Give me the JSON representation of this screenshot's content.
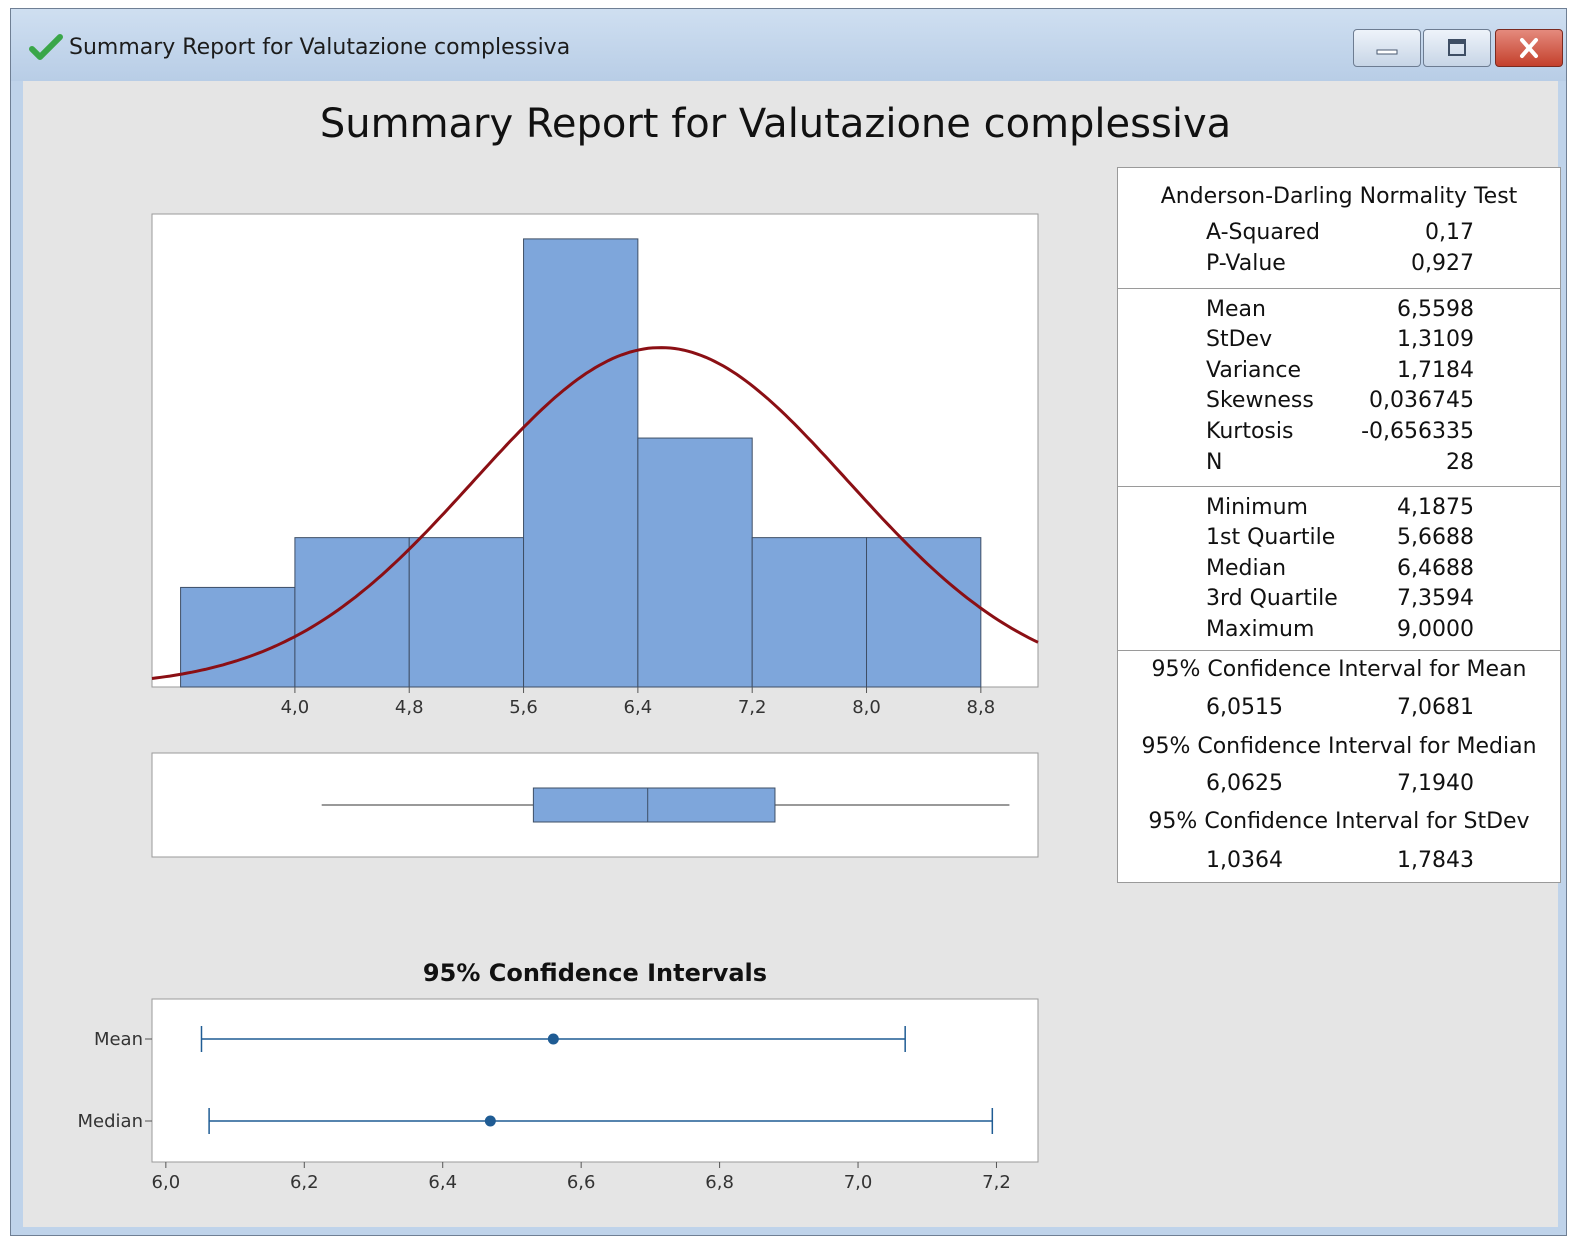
{
  "window": {
    "title": "Summary Report for Valutazione complessiva",
    "icon": "green-checkmark-icon",
    "buttons": [
      "minimize-icon",
      "maximize-icon",
      "close-icon"
    ]
  },
  "report": {
    "title": "Summary Report for Valutazione complessiva"
  },
  "stats": {
    "ad_heading": "Anderson-Darling Normality Test",
    "ad": [
      {
        "label": "A-Squared",
        "value": "0,17"
      },
      {
        "label": "P-Value",
        "value": "0,927"
      }
    ],
    "moments": [
      {
        "label": "Mean",
        "value": "6,5598"
      },
      {
        "label": "StDev",
        "value": "1,3109"
      },
      {
        "label": "Variance",
        "value": "1,7184"
      },
      {
        "label": "Skewness",
        "value": "0,036745"
      },
      {
        "label": "Kurtosis",
        "value": "-0,656335"
      },
      {
        "label": "N",
        "value": "28"
      }
    ],
    "quantiles": [
      {
        "label": "Minimum",
        "value": "4,1875"
      },
      {
        "label": "1st Quartile",
        "value": "5,6688"
      },
      {
        "label": "Median",
        "value": "6,4688"
      },
      {
        "label": "3rd Quartile",
        "value": "7,3594"
      },
      {
        "label": "Maximum",
        "value": "9,0000"
      }
    ],
    "ci": [
      {
        "heading": "95% Confidence Interval for Mean",
        "low": "6,0515",
        "high": "7,0681"
      },
      {
        "heading": "95% Confidence Interval for Median",
        "low": "6,0625",
        "high": "7,1940"
      },
      {
        "heading": "95% Confidence Interval for StDev",
        "low": "1,0364",
        "high": "1,7843"
      }
    ]
  },
  "chart_data": [
    {
      "type": "bar",
      "subtype": "histogram-with-normal-fit",
      "bin_centers": [
        3.6,
        4.4,
        5.2,
        6.0,
        6.8,
        7.6,
        8.4
      ],
      "bin_width": 0.8,
      "counts": [
        2,
        3,
        3,
        9,
        5,
        3,
        3
      ],
      "xlim": [
        3.0,
        9.2
      ],
      "ylim": [
        0,
        9.5
      ],
      "xticks": [
        "4,0",
        "4,8",
        "5,6",
        "6,4",
        "7,2",
        "8,0",
        "8,8"
      ],
      "xtick_values": [
        4.0,
        4.8,
        5.6,
        6.4,
        7.2,
        8.0,
        8.8
      ],
      "normal_fit": {
        "mean": 6.5598,
        "stdev": 1.3109
      },
      "bar_color": "#7ea6db",
      "curve_color": "#8b0f14"
    },
    {
      "type": "boxplot",
      "min": 4.1875,
      "q1": 5.6688,
      "median": 6.4688,
      "q3": 7.3594,
      "max": 9.0,
      "xlim": [
        3.0,
        9.2
      ],
      "box_color": "#7ea6db"
    },
    {
      "type": "interval",
      "title": "95% Confidence Intervals",
      "categories": [
        "Mean",
        "Median"
      ],
      "points": [
        6.5598,
        6.4688
      ],
      "lows": [
        6.0515,
        6.0625
      ],
      "highs": [
        7.0681,
        7.194
      ],
      "xlim": [
        5.98,
        7.26
      ],
      "xticks": [
        "6,0",
        "6,2",
        "6,4",
        "6,6",
        "6,8",
        "7,0",
        "7,2"
      ],
      "xtick_values": [
        6.0,
        6.2,
        6.4,
        6.6,
        6.8,
        7.0,
        7.2
      ],
      "color": "#1f5c94"
    }
  ]
}
